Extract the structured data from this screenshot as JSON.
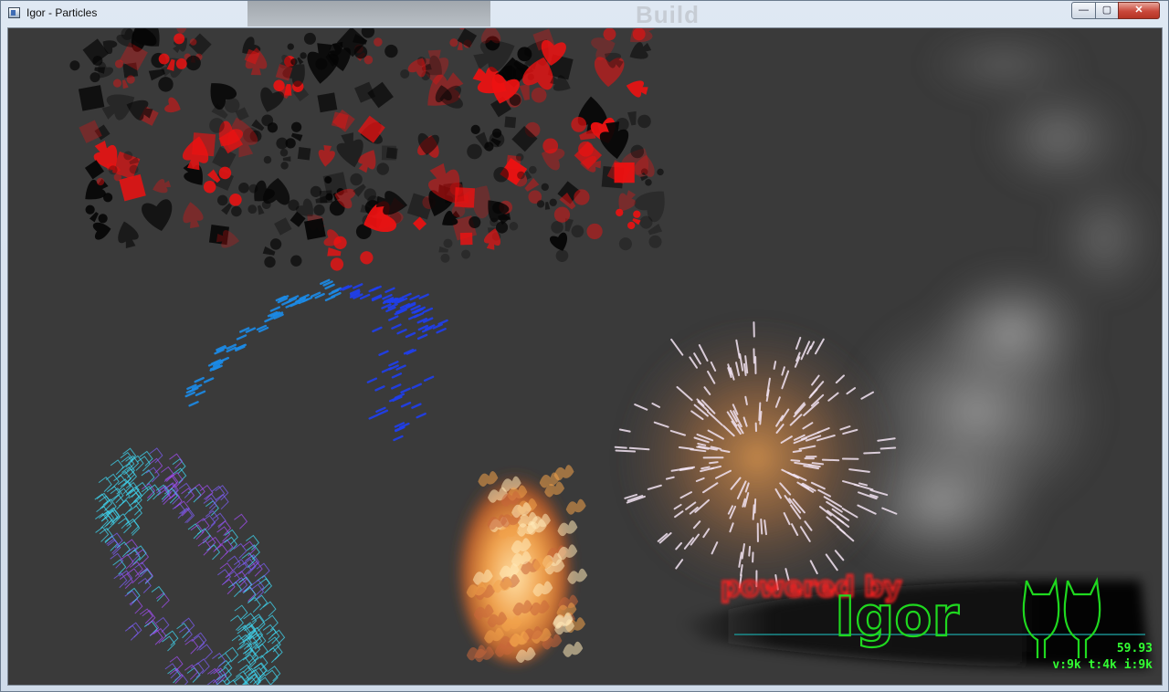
{
  "window": {
    "title": "Igor - Particles",
    "background_app_text": "Build",
    "controls": {
      "minimize": "—",
      "maximize": "▢",
      "close": "✕"
    }
  },
  "logo": {
    "tagline": "powered by",
    "name": "Igor"
  },
  "hud": {
    "fps": "59.93",
    "stats": "v:9k t:4k i:9k"
  },
  "colors": {
    "viewport_bg": "#3a3a3a",
    "hud_green": "#33ff33",
    "logo_green": "#1fd81f",
    "tagline_red": "#e01616"
  }
}
